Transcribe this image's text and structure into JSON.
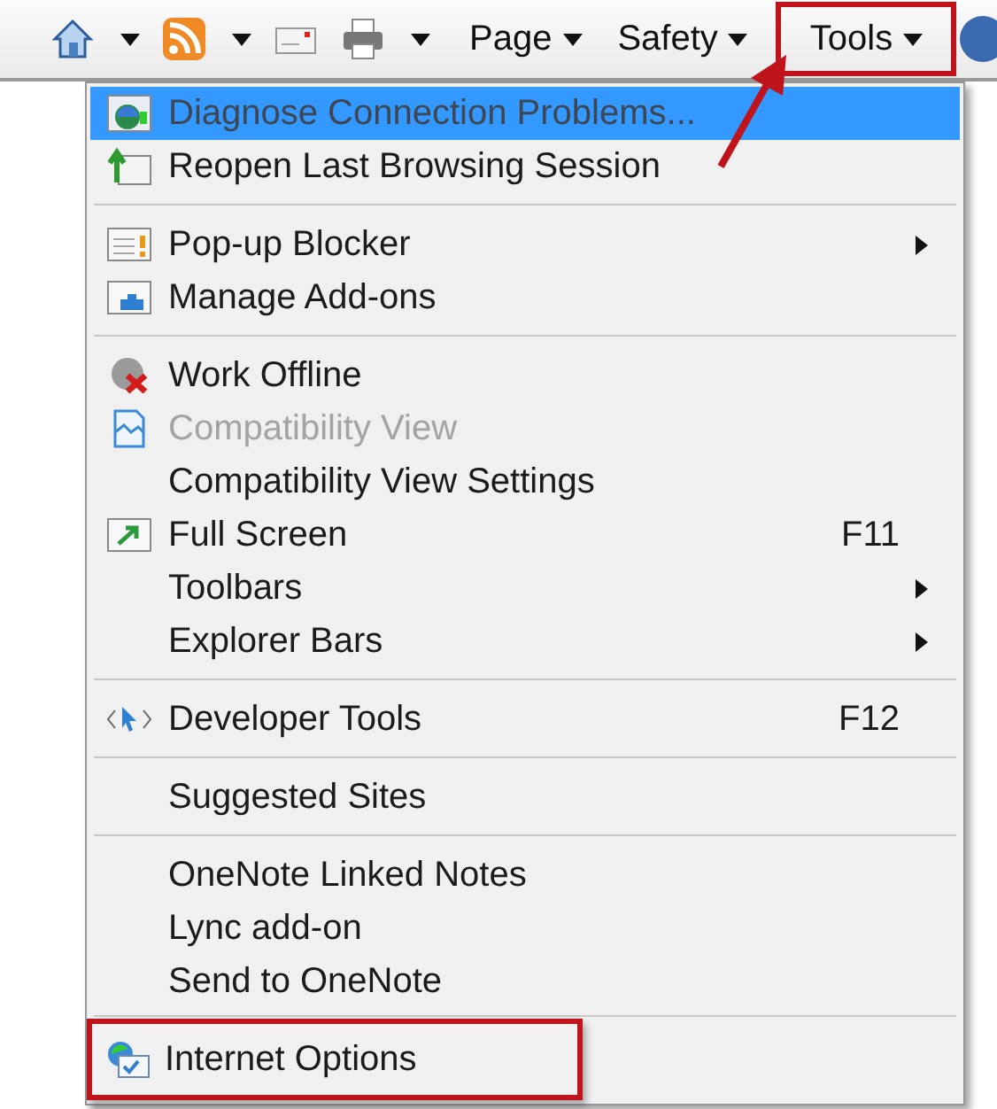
{
  "toolbar": {
    "buttons": [
      {
        "kind": "home",
        "dropdown": true
      },
      {
        "kind": "feed",
        "dropdown": true
      },
      {
        "kind": "mail",
        "dropdown": false
      },
      {
        "kind": "print",
        "dropdown": true
      }
    ],
    "menus": [
      {
        "label": "Page",
        "highlighted": false
      },
      {
        "label": "Safety",
        "highlighted": false
      },
      {
        "label": "Tools",
        "highlighted": true
      }
    ]
  },
  "menu": {
    "groups": [
      {
        "items": [
          {
            "kind": "diagnose",
            "label": "Diagnose Connection Problems...",
            "disabled": true,
            "selected": true,
            "submenu": false,
            "highlighted": false
          },
          {
            "kind": "reopen",
            "label": "Reopen Last Browsing Session",
            "disabled": false,
            "selected": false,
            "submenu": false,
            "highlighted": false
          }
        ]
      },
      {
        "items": [
          {
            "kind": "popup",
            "label": "Pop-up Blocker",
            "disabled": false,
            "selected": false,
            "submenu": true,
            "highlighted": false
          },
          {
            "kind": "addons",
            "label": "Manage Add-ons",
            "disabled": false,
            "selected": false,
            "submenu": false,
            "highlighted": false
          }
        ]
      },
      {
        "items": [
          {
            "kind": "offline",
            "label": "Work Offline",
            "disabled": false,
            "selected": false,
            "submenu": false,
            "highlighted": false
          },
          {
            "kind": "compat",
            "label": "Compatibility View",
            "disabled": true,
            "selected": false,
            "submenu": false,
            "highlighted": false
          },
          {
            "kind": "none",
            "label": "Compatibility View Settings",
            "disabled": false,
            "selected": false,
            "submenu": false,
            "highlighted": false
          },
          {
            "kind": "fullscreen",
            "label": "Full Screen",
            "shortcut": "F11",
            "disabled": false,
            "selected": false,
            "submenu": false,
            "highlighted": false
          },
          {
            "kind": "none",
            "label": "Toolbars",
            "disabled": false,
            "selected": false,
            "submenu": true,
            "highlighted": false
          },
          {
            "kind": "none",
            "label": "Explorer Bars",
            "disabled": false,
            "selected": false,
            "submenu": true,
            "highlighted": false
          }
        ]
      },
      {
        "items": [
          {
            "kind": "devtools",
            "label": "Developer Tools",
            "shortcut": "F12",
            "disabled": false,
            "selected": false,
            "submenu": false,
            "highlighted": false
          }
        ]
      },
      {
        "items": [
          {
            "kind": "none",
            "label": "Suggested Sites",
            "disabled": false,
            "selected": false,
            "submenu": false,
            "highlighted": false
          }
        ]
      },
      {
        "items": [
          {
            "kind": "none",
            "label": "OneNote Linked Notes",
            "disabled": false,
            "selected": false,
            "submenu": false,
            "highlighted": false
          },
          {
            "kind": "none",
            "label": "Lync add-on",
            "disabled": false,
            "selected": false,
            "submenu": false,
            "highlighted": false
          },
          {
            "kind": "none",
            "label": "Send to OneNote",
            "disabled": false,
            "selected": false,
            "submenu": false,
            "highlighted": false
          }
        ]
      },
      {
        "items": [
          {
            "kind": "options",
            "label": "Internet Options",
            "disabled": false,
            "selected": false,
            "submenu": false,
            "highlighted": true
          }
        ]
      }
    ]
  }
}
